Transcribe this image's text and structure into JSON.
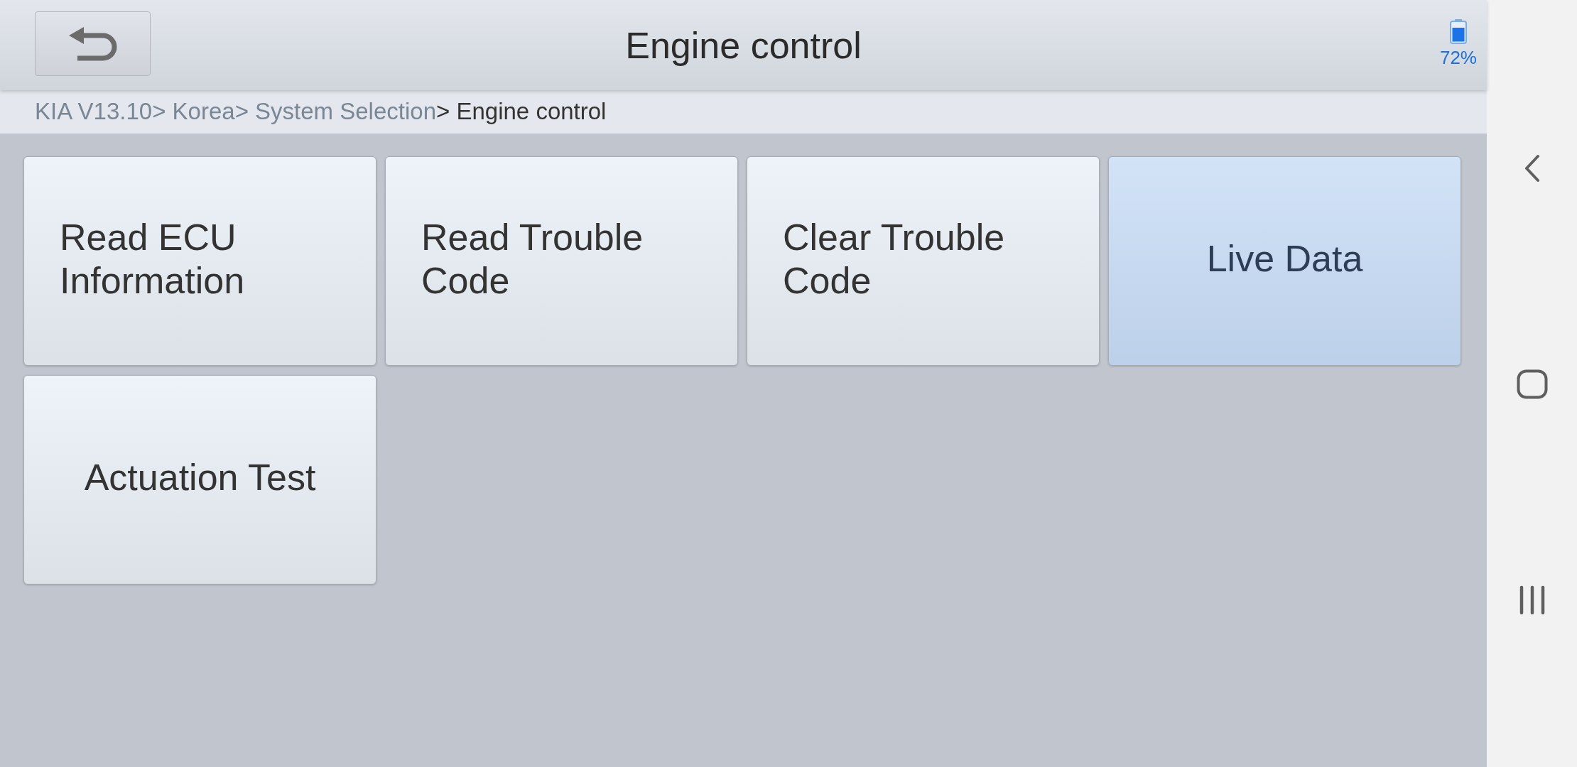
{
  "header": {
    "title": "Engine control",
    "battery": "72%"
  },
  "breadcrumb": {
    "path": "KIA V13.10> Korea> System Selection",
    "current": "> Engine control"
  },
  "menu": [
    {
      "label": "Read ECU Information",
      "selected": false
    },
    {
      "label": "Read Trouble Code",
      "selected": false
    },
    {
      "label": "Clear Trouble Code",
      "selected": false
    },
    {
      "label": "Live Data",
      "selected": true
    },
    {
      "label": "Actuation Test",
      "selected": false
    }
  ]
}
